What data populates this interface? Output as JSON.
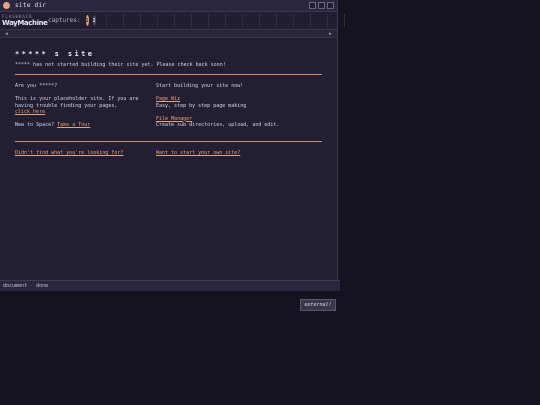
{
  "window": {
    "title": "site dir"
  },
  "logo": {
    "line1": "FLASHBACK",
    "line2": "WayMachine"
  },
  "toolbar": {
    "captures_label": "captures:",
    "captures": [
      "1",
      "2"
    ]
  },
  "nav": {
    "back": "◀",
    "forward": "▶"
  },
  "page": {
    "title": "***** s site",
    "intro": "***** has not started building their site yet. Please check back soon!",
    "left": {
      "question": "Are you *****?",
      "p1": "This is your placeholder site. If you are having trouble finding your pages,",
      "click_here": "click here",
      "new_to": "New to Space?",
      "tour": "Take a Tour"
    },
    "right": {
      "heading": "Start building your site now!",
      "page_wiz": "Page Wiz",
      "page_wiz_desc": "Easy, step by step page making",
      "file_manager": "File Manager",
      "file_manager_desc": "Create sub directories, upload, and edit."
    },
    "footer_left": "Didn't find what you're looking for?",
    "footer_right": "Want to start your own site?"
  },
  "status": {
    "left": "document",
    "sep": "·",
    "right": "done"
  },
  "external_button": "external!"
}
